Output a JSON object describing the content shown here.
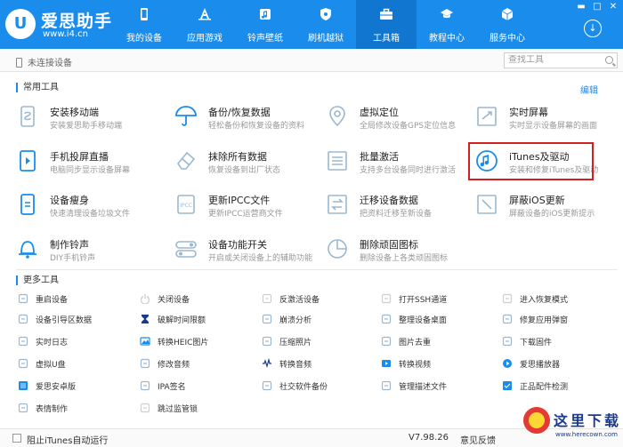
{
  "app": {
    "name": "爱思助手",
    "url": "www.i4.cn",
    "logo_glyph": "U"
  },
  "nav": [
    {
      "label": "我的设备",
      "icon": "phone-icon",
      "active": false
    },
    {
      "label": "应用游戏",
      "icon": "app-store-icon",
      "active": false
    },
    {
      "label": "铃声壁纸",
      "icon": "music-note-icon",
      "active": false
    },
    {
      "label": "刷机越狱",
      "icon": "shield-icon",
      "active": false
    },
    {
      "label": "工具箱",
      "icon": "toolbox-icon",
      "active": true
    },
    {
      "label": "教程中心",
      "icon": "graduation-cap-icon",
      "active": false
    },
    {
      "label": "服务中心",
      "icon": "cube-icon",
      "active": false
    }
  ],
  "window": {
    "minimize": "▬",
    "maximize": "□",
    "close": "✕",
    "download": "↓"
  },
  "subbar": {
    "device_status": "未连接设备",
    "search_placeholder": "查找工具"
  },
  "common": {
    "title": "常用工具",
    "edit": "编辑",
    "tools": [
      {
        "name": "安装移动端",
        "desc": "安装爱思助手移动端",
        "icon": "install-mobile-icon",
        "color": "#9bb8d0"
      },
      {
        "name": "备份/恢复数据",
        "desc": "轻松备份和恢复设备的资料",
        "icon": "umbrella-icon",
        "color": "#1a8ceb"
      },
      {
        "name": "虚拟定位",
        "desc": "全局修改设备GPS定位信息",
        "icon": "location-pin-icon",
        "color": "#9bb8d0"
      },
      {
        "name": "实时屏幕",
        "desc": "实时显示设备屏幕的画面",
        "icon": "screen-icon",
        "color": "#9bb8d0"
      },
      {
        "name": "手机投屏直播",
        "desc": "电脑同步显示设备屏幕",
        "icon": "cast-icon",
        "color": "#1a8ceb"
      },
      {
        "name": "抹除所有数据",
        "desc": "恢复设备到出厂状态",
        "icon": "eraser-icon",
        "color": "#9bb8d0"
      },
      {
        "name": "批量激活",
        "desc": "支持多台设备同时进行激活",
        "icon": "batch-activate-icon",
        "color": "#9bb8d0"
      },
      {
        "name": "iTunes及驱动",
        "desc": "安装和修复iTunes及驱动",
        "icon": "itunes-icon",
        "color": "#1a8ceb"
      },
      {
        "name": "设备瘦身",
        "desc": "快速清理设备垃圾文件",
        "icon": "slim-device-icon",
        "color": "#1a8ceb"
      },
      {
        "name": "更新IPCC文件",
        "desc": "更新IPCC运营商文件",
        "icon": "ipcc-file-icon",
        "color": "#9bb8d0"
      },
      {
        "name": "迁移设备数据",
        "desc": "把资料迁移至新设备",
        "icon": "migrate-icon",
        "color": "#9bb8d0"
      },
      {
        "name": "屏蔽iOS更新",
        "desc": "屏蔽设备的iOS更新提示",
        "icon": "block-update-icon",
        "color": "#9bb8d0"
      },
      {
        "name": "制作铃声",
        "desc": "DIY手机铃声",
        "icon": "bell-icon",
        "color": "#1a8ceb"
      },
      {
        "name": "设备功能开关",
        "desc": "开启或关闭设备上的辅助功能",
        "icon": "toggle-icon",
        "color": "#9bb8d0"
      },
      {
        "name": "删除顽固图标",
        "desc": "删除设备上各类顽固图标",
        "icon": "pie-chart-icon",
        "color": "#9bb8d0"
      }
    ]
  },
  "more": {
    "title": "更多工具",
    "tools": [
      {
        "label": "重启设备",
        "icon": "restart-icon",
        "color": "#9bb8d0"
      },
      {
        "label": "关闭设备",
        "icon": "power-icon",
        "color": "#cfcfcf"
      },
      {
        "label": "反激活设备",
        "icon": "deactivate-icon",
        "color": "#cfcfcf"
      },
      {
        "label": "打开SSH通道",
        "icon": "ssh-icon",
        "color": "#cfcfcf"
      },
      {
        "label": "进入恢复模式",
        "icon": "recovery-icon",
        "color": "#cfcfcf"
      },
      {
        "label": "设备引导区数据",
        "icon": "boot-data-icon",
        "color": "#9bb8d0"
      },
      {
        "label": "破解时间限额",
        "icon": "hourglass-icon",
        "color": "#1b3a8c"
      },
      {
        "label": "崩溃分析",
        "icon": "crash-analysis-icon",
        "color": "#9bb8d0"
      },
      {
        "label": "整理设备桌面",
        "icon": "desktop-icon",
        "color": "#9bb8d0"
      },
      {
        "label": "修复应用弹窗",
        "icon": "fix-popup-icon",
        "color": "#9bb8d0"
      },
      {
        "label": "实时日志",
        "icon": "log-icon",
        "color": "#9bb8d0"
      },
      {
        "label": "转换HEIC图片",
        "icon": "heic-icon",
        "color": "#1a8ceb"
      },
      {
        "label": "压缩照片",
        "icon": "compress-icon",
        "color": "#9bb8d0"
      },
      {
        "label": "图片去重",
        "icon": "dedupe-icon",
        "color": "#9bb8d0"
      },
      {
        "label": "下载固件",
        "icon": "firmware-icon",
        "color": "#9bb8d0"
      },
      {
        "label": "虚拟U盘",
        "icon": "usb-icon",
        "color": "#9bb8d0"
      },
      {
        "label": "修改音频",
        "icon": "edit-audio-icon",
        "color": "#9bb8d0"
      },
      {
        "label": "转换音频",
        "icon": "convert-audio-icon",
        "color": "#1b3a8c"
      },
      {
        "label": "转换视频",
        "icon": "convert-video-icon",
        "color": "#1a8ceb"
      },
      {
        "label": "爱思播放器",
        "icon": "player-icon",
        "color": "#1a8ceb"
      },
      {
        "label": "爱思安卓版",
        "icon": "android-icon",
        "color": "#1a8ceb"
      },
      {
        "label": "IPA签名",
        "icon": "ipa-sign-icon",
        "color": "#9bb8d0"
      },
      {
        "label": "社交软件备份",
        "icon": "social-backup-icon",
        "color": "#9bb8d0"
      },
      {
        "label": "管理描述文件",
        "icon": "profile-icon",
        "color": "#9bb8d0"
      },
      {
        "label": "正品配件检测",
        "icon": "accessory-check-icon",
        "color": "#1a8ceb"
      },
      {
        "label": "表情制作",
        "icon": "emoji-icon",
        "color": "#9bb8d0"
      },
      {
        "label": "跳过监管锁",
        "icon": "skip-lock-icon",
        "color": "#cfcfcf"
      }
    ]
  },
  "footer": {
    "checkbox_label": "阻止iTunes自动运行",
    "version": "V7.98.26",
    "feedback": "意见反馈"
  },
  "watermark": {
    "text": "这里下载",
    "url": "www.herecown.com"
  }
}
